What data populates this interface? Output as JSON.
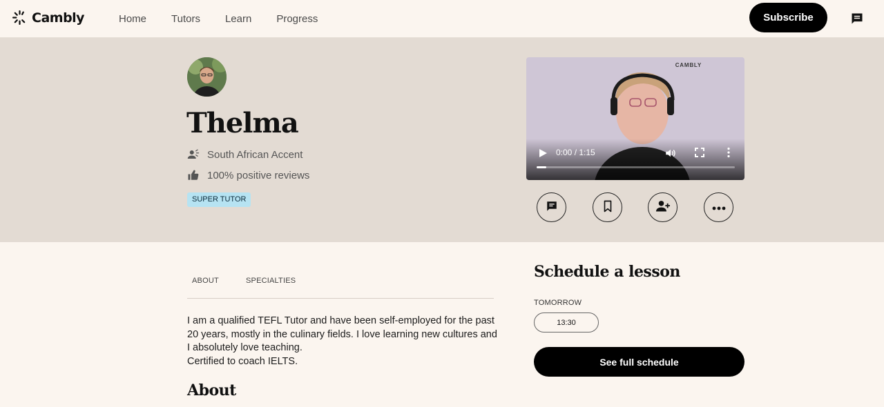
{
  "header": {
    "logo_text": "Cambly",
    "nav": [
      {
        "label": "Home"
      },
      {
        "label": "Tutors"
      },
      {
        "label": "Learn"
      },
      {
        "label": "Progress"
      }
    ],
    "subscribe_label": "Subscribe",
    "messages_icon": "chat-bubble-icon"
  },
  "tutor": {
    "name": "Thelma",
    "accent": "South African Accent",
    "reviews": "100% positive reviews",
    "badge": "SUPER TUTOR"
  },
  "video": {
    "watermark": "CAMBLY",
    "time": "0:00 / 1:15",
    "progress": 0.05
  },
  "actions": [
    {
      "icon": "message-icon"
    },
    {
      "icon": "bookmark-icon"
    },
    {
      "icon": "add-person-icon"
    },
    {
      "icon": "more-icon"
    }
  ],
  "tabs": [
    {
      "label": "ABOUT"
    },
    {
      "label": "SPECIALTIES"
    }
  ],
  "bio": {
    "text": "I am a qualified TEFL Tutor and have been self-employed for the past 20 years, mostly in the culinary fields. I love learning new cultures and I absolutely love teaching.",
    "cert": "Certified to coach IELTS."
  },
  "about_heading": "About",
  "schedule": {
    "title": "Schedule a lesson",
    "day_label": "TOMORROW",
    "slot": "13:30",
    "full_label": "See full schedule"
  },
  "colors": {
    "page_bg": "#fbf5ef",
    "hero_bg": "#e3dbd3",
    "badge_bg": "#b6e3f2",
    "primary": "#000000"
  }
}
